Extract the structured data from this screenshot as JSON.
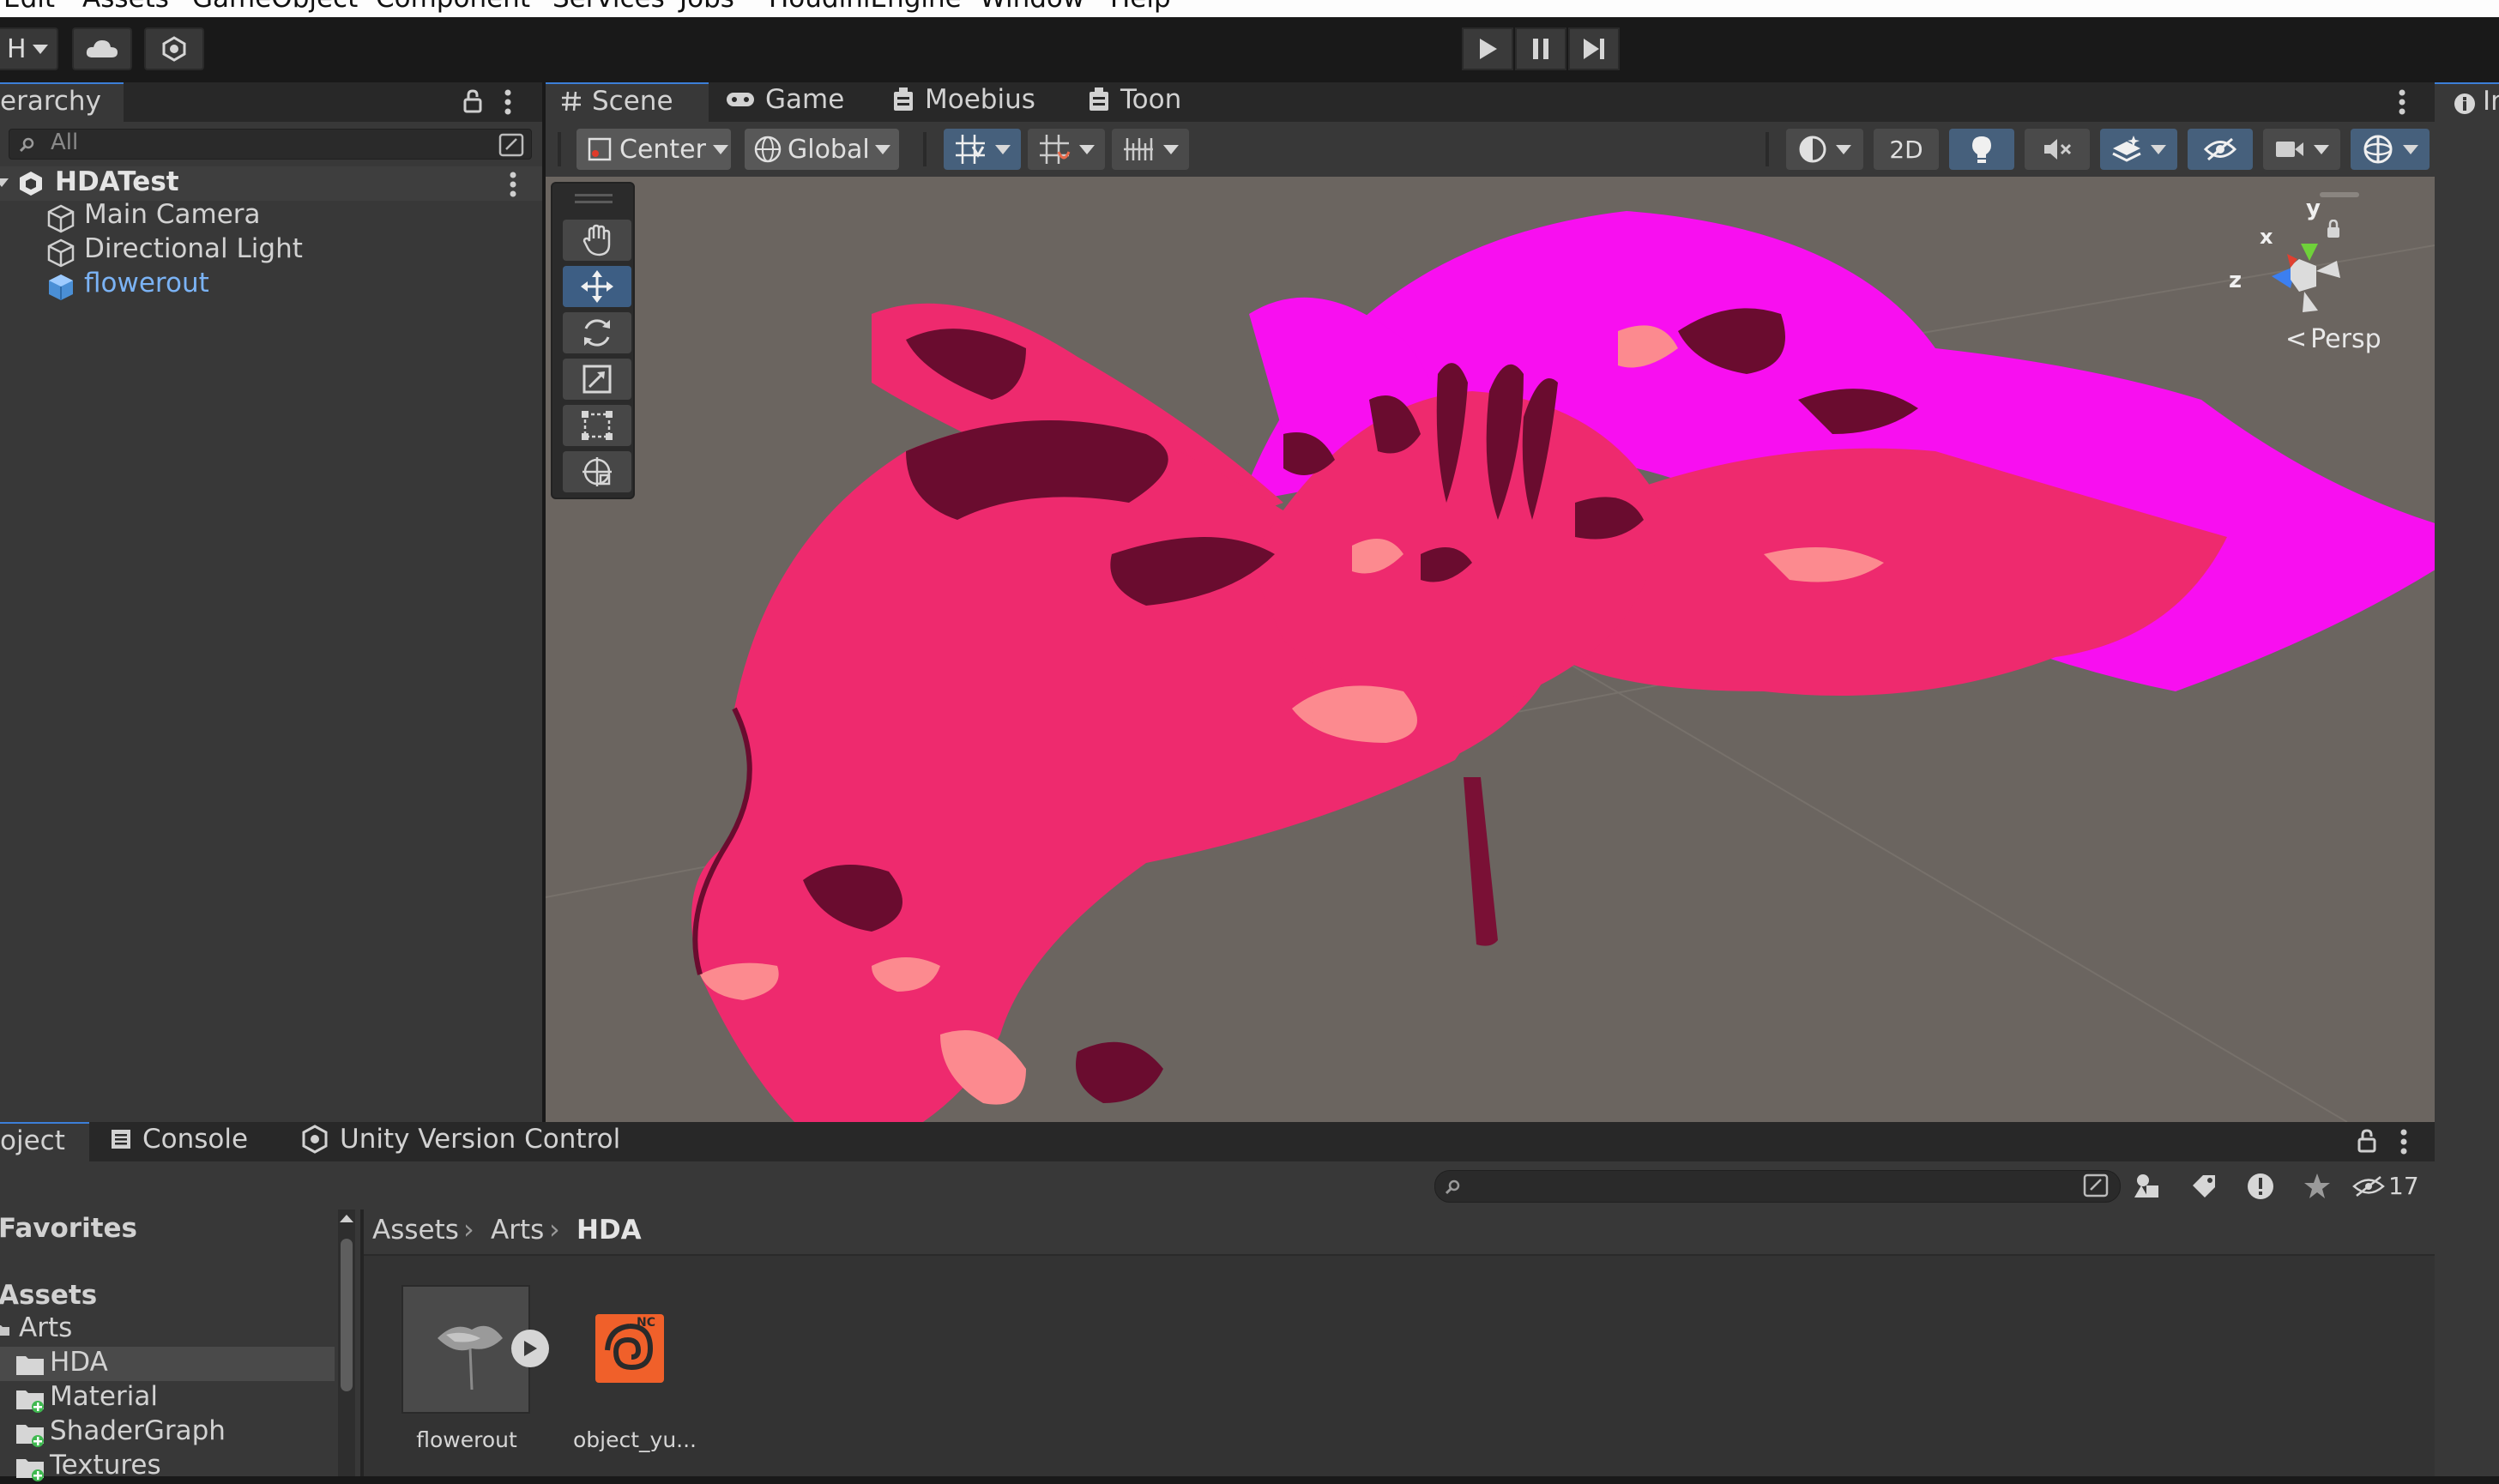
{
  "menu": [
    "Edit",
    "Assets",
    "GameObject",
    "Component",
    "Services",
    "Jobs",
    "HoudiniEngine",
    "Window",
    "Help"
  ],
  "toolbar": {
    "account_initial": "H"
  },
  "hierarchy": {
    "tab_label": "erarchy",
    "search_placeholder": "All",
    "scene_name": "HDATest",
    "items": [
      {
        "label": "Main Camera"
      },
      {
        "label": "Directional Light"
      },
      {
        "label": "flowerout"
      }
    ]
  },
  "scene_tabs": [
    {
      "label": "Scene"
    },
    {
      "label": "Game"
    },
    {
      "label": "Moebius"
    },
    {
      "label": "Toon"
    }
  ],
  "scene_toolbar": {
    "pivot_label": "Center",
    "space_label": "Global",
    "view_2d_label": "2D"
  },
  "gizmo": {
    "x": "x",
    "y": "y",
    "z": "z",
    "persp_label": "Persp"
  },
  "inspector_tab_label": "In",
  "bottom_tabs": [
    {
      "label": "oject"
    },
    {
      "label": "Console"
    },
    {
      "label": "Unity Version Control"
    }
  ],
  "project": {
    "hidden_count": "17",
    "tree": {
      "favorites_label": "Favorites",
      "assets_label": "Assets",
      "arts_label": "Arts",
      "folders": [
        {
          "label": "HDA"
        },
        {
          "label": "Material"
        },
        {
          "label": "ShaderGraph"
        },
        {
          "label": "Textures"
        }
      ]
    },
    "breadcrumb": [
      "Assets",
      "Arts",
      "HDA"
    ],
    "assets": [
      {
        "label": "flowerout"
      },
      {
        "label": "object_yu..."
      }
    ]
  },
  "colors": {
    "petal_pink": "#ee2a6e",
    "petal_magenta": "#f80ff0",
    "petal_shadow": "#6a0c2f",
    "petal_light": "#fc8a8f",
    "scene_bg": "#6b6560",
    "selected_text": "#7bb3f5",
    "active_button": "#46607c"
  }
}
